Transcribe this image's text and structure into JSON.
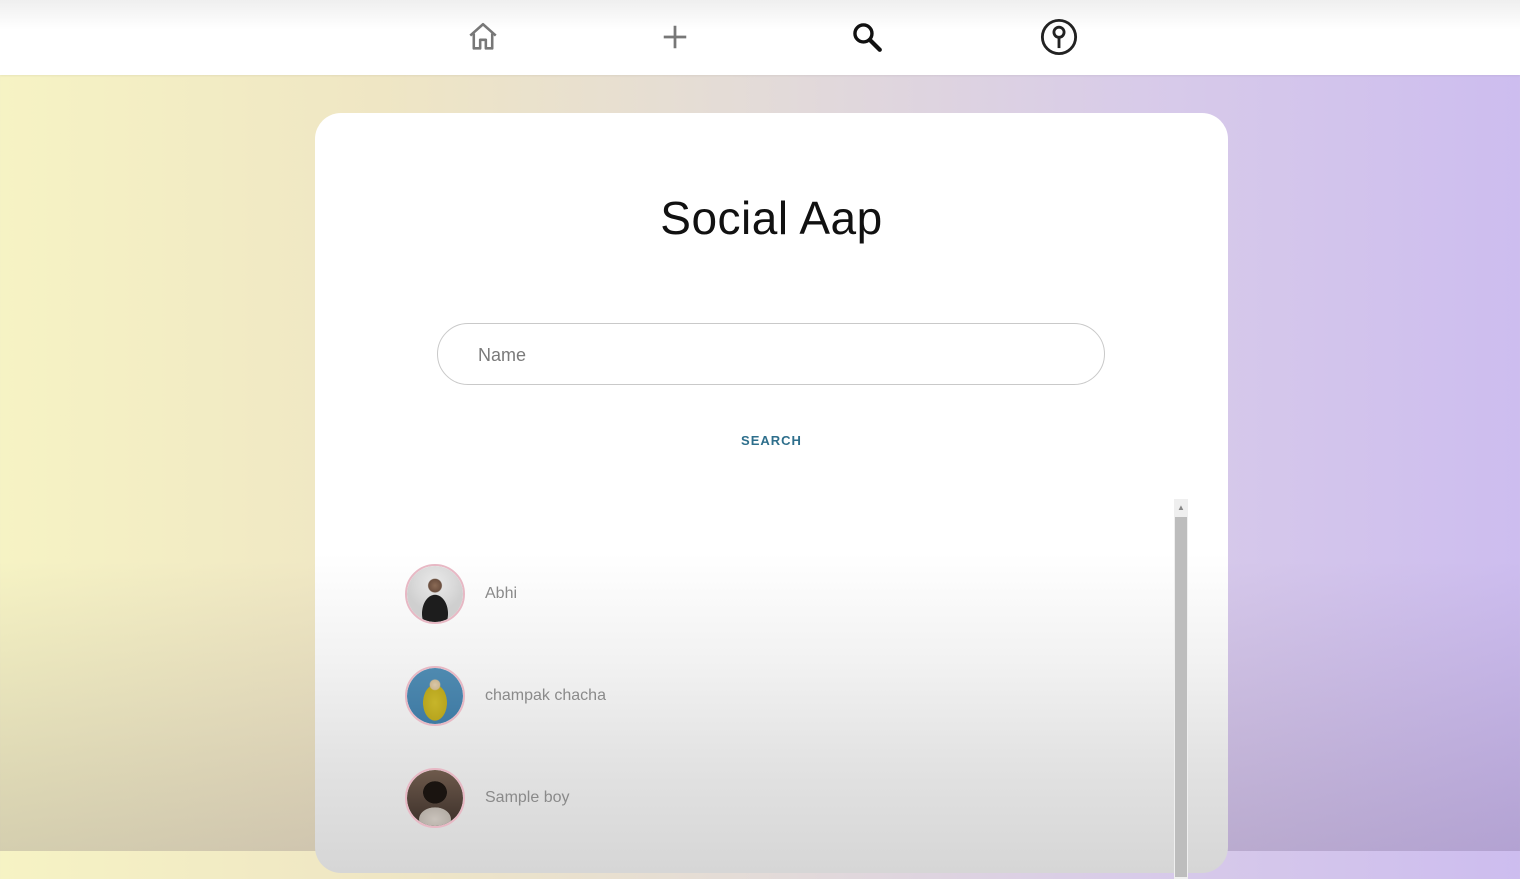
{
  "navbar": {
    "items": [
      {
        "icon": "home-icon"
      },
      {
        "icon": "plus-icon"
      },
      {
        "icon": "search-icon"
      },
      {
        "icon": "profile-icon"
      }
    ]
  },
  "card": {
    "title": "Social Aap",
    "search": {
      "placeholder": "Name",
      "value": ""
    },
    "search_button_label": "SEARCH",
    "results": [
      {
        "name": "Abhi"
      },
      {
        "name": "champak chacha"
      },
      {
        "name": "Sample boy"
      }
    ]
  },
  "colors": {
    "accent": "#2e6f8c",
    "avatar_border": "#e7b8c4"
  }
}
